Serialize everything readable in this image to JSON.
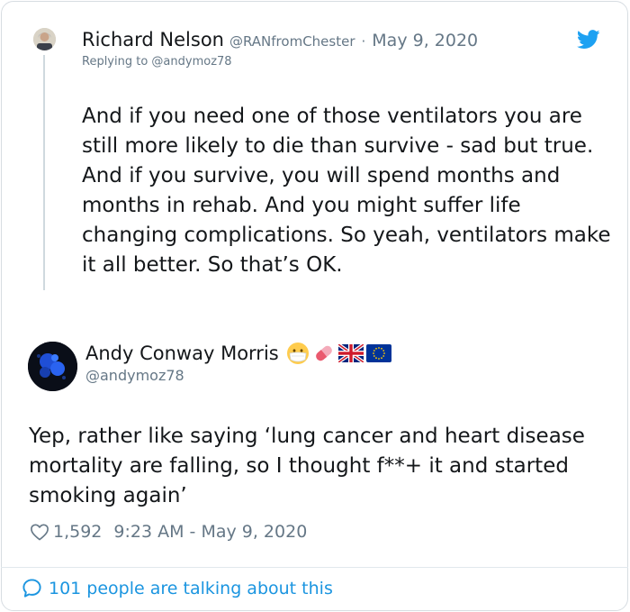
{
  "parent_tweet": {
    "name": "Richard Nelson",
    "handle": "@RANfromChester",
    "separator": "·",
    "date": "May 9, 2020",
    "replying_to": "Replying to @andymoz78",
    "text": "And if you need one of those ventilators you are still more likely to die than survive - sad but true. And if you survive, you will spend months and months in rehab. And you might suffer life changing complications. So yeah, ventilators make it all better. So that’s OK."
  },
  "main_tweet": {
    "name": "Andy Conway Morris",
    "name_emojis": [
      "face-with-medical-mask",
      "pill",
      "flag-united-kingdom",
      "flag-european-union"
    ],
    "handle": "@andymoz78",
    "text": "Yep, rather like saying ‘lung cancer and heart disease mortality are falling, so I thought f**+ it and started smoking again’",
    "likes": "1,592",
    "timestamp": "9:23 AM - May 9, 2020"
  },
  "footer": {
    "talking": "101 people are talking about this"
  },
  "colors": {
    "twitter_blue": "#1da1f2",
    "link_blue": "#1b95e0",
    "secondary_text": "#657786",
    "primary_text": "#14171a",
    "border": "#d7dde2"
  }
}
